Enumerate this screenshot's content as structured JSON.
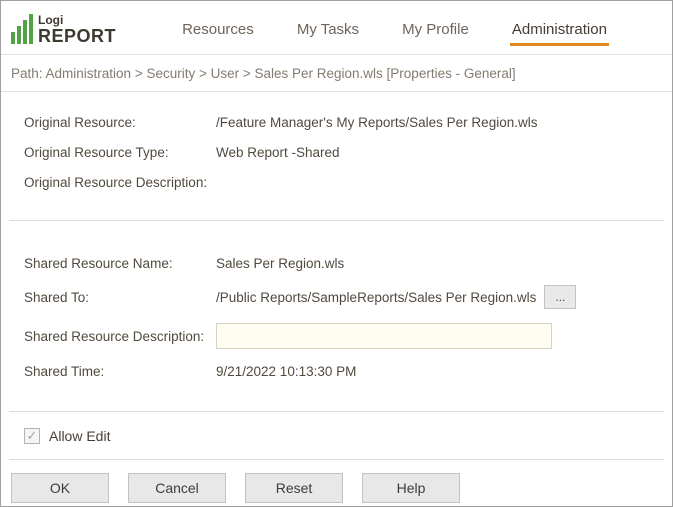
{
  "header": {
    "logo": {
      "top": "Logi",
      "main": "REPORT"
    },
    "nav": [
      {
        "label": "Resources",
        "active": false
      },
      {
        "label": "My Tasks",
        "active": false
      },
      {
        "label": "My Profile",
        "active": false
      },
      {
        "label": "Administration",
        "active": true
      }
    ]
  },
  "breadcrumb": "Path: Administration > Security > User > Sales Per Region.wls [Properties - General]",
  "form": {
    "original_resource": {
      "label": "Original Resource:",
      "value": "/Feature Manager's My Reports/Sales Per Region.wls"
    },
    "original_resource_type": {
      "label": "Original Resource Type:",
      "value": "Web Report -Shared"
    },
    "original_resource_description": {
      "label": "Original Resource Description:",
      "value": ""
    },
    "shared_resource_name": {
      "label": "Shared Resource Name:",
      "value": "Sales Per Region.wls"
    },
    "shared_to": {
      "label": "Shared To:",
      "value": "/Public Reports/SampleReports/Sales Per Region.wls"
    },
    "shared_resource_description": {
      "label": "Shared Resource Description:",
      "value": ""
    },
    "shared_time": {
      "label": "Shared Time:",
      "value": "9/21/2022 10:13:30 PM"
    },
    "allow_edit": {
      "label": "Allow Edit",
      "checked": true
    }
  },
  "icons": {
    "browse": "...",
    "check": "✓"
  },
  "buttons": {
    "ok": "OK",
    "cancel": "Cancel",
    "reset": "Reset",
    "help": "Help"
  },
  "colors": {
    "accent_orange": "#e08a1e",
    "logo_green": "#53a245",
    "text": "#51493e"
  }
}
